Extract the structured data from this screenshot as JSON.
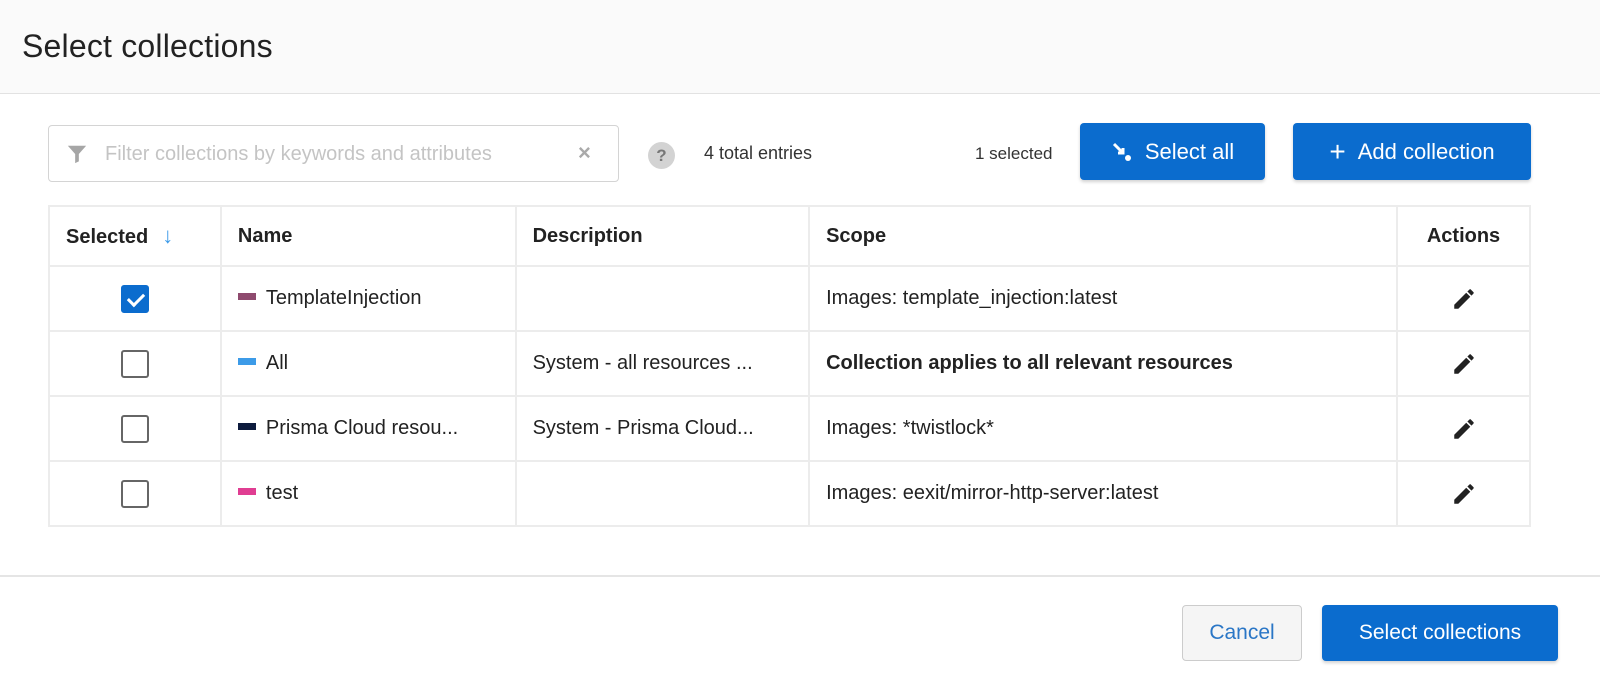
{
  "dialog": {
    "title": "Select collections"
  },
  "toolbar": {
    "filter_placeholder": "Filter collections by keywords and attributes",
    "filter_value": "",
    "clear_icon": "×",
    "help_icon": "?",
    "total_entries": "4 total entries",
    "selected_count": "1 selected",
    "select_all_label": "Select all",
    "add_collection_label": "Add collection",
    "add_icon": "+"
  },
  "table": {
    "columns": {
      "selected": "Selected",
      "name": "Name",
      "description": "Description",
      "scope": "Scope",
      "actions": "Actions"
    },
    "sort_icon": "↓",
    "rows": [
      {
        "selected": true,
        "color": "#8e4a6e",
        "name": "TemplateInjection",
        "description": "",
        "scope": "Images: template_injection:latest",
        "scope_bold": false
      },
      {
        "selected": false,
        "color": "#3c9be8",
        "name": "All",
        "description": "System - all resources ...",
        "scope": "Collection applies to all relevant resources",
        "scope_bold": true
      },
      {
        "selected": false,
        "color": "#0d1b3d",
        "name": "Prisma Cloud resou...",
        "description": "System - Prisma Cloud...",
        "scope": "Images: *twistlock*",
        "scope_bold": false
      },
      {
        "selected": false,
        "color": "#e03d92",
        "name": "test",
        "description": "",
        "scope": "Images: eexit/mirror-http-server:latest",
        "scope_bold": false
      }
    ]
  },
  "footer": {
    "cancel_label": "Cancel",
    "confirm_label": "Select collections"
  },
  "colors": {
    "primary": "#0b6cce",
    "sort_arrow": "#3d9be9"
  }
}
